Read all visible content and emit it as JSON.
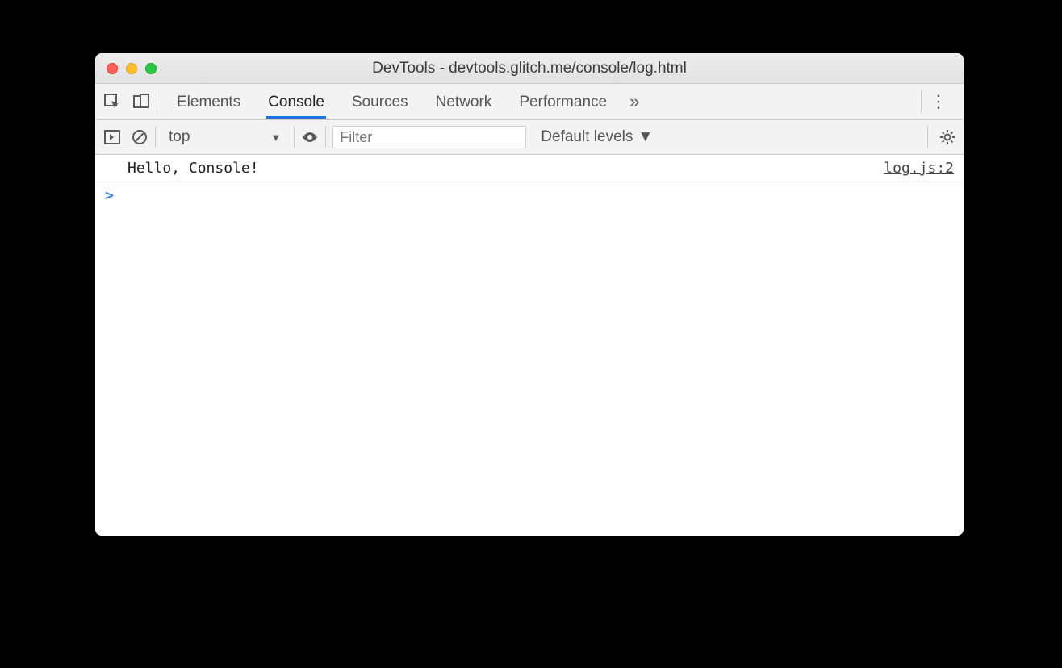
{
  "window_title": "DevTools - devtools.glitch.me/console/log.html",
  "tabs": [
    "Elements",
    "Console",
    "Sources",
    "Network",
    "Performance"
  ],
  "active_tab": "Console",
  "toolbar": {
    "context": "top",
    "filter_placeholder": "Filter",
    "levels": "Default levels"
  },
  "console": {
    "log_message": "Hello, Console!",
    "log_source": "log.js:2",
    "prompt": ">"
  }
}
